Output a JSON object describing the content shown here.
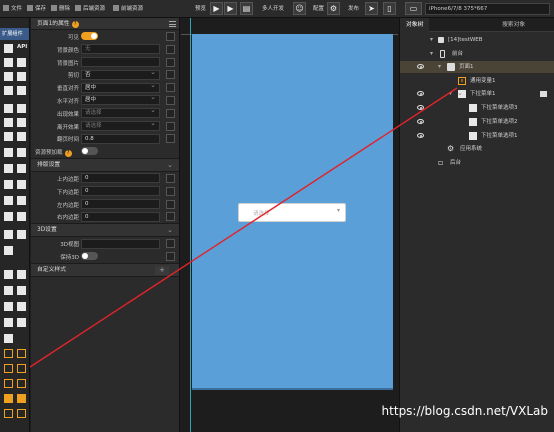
{
  "toolbar": {
    "file": "文件",
    "save": "保存",
    "delete": "删除",
    "preview_res": "后端资源",
    "front_res": "前端资源",
    "preview": "预览",
    "multi_dev": "多人开发",
    "config": "配置",
    "publish": "发布",
    "device": "iPhone6/7/8 375*667"
  },
  "left_tools": {
    "tab": "扩展组件",
    "api": "API"
  },
  "props": {
    "title": "页面1的属性",
    "rows": [
      {
        "label": "可见",
        "type": "toggle_on"
      },
      {
        "label": "背景颜色",
        "value": "无",
        "ph": true
      },
      {
        "label": "背景图片",
        "value": ""
      },
      {
        "label": "剪切",
        "value": "否"
      },
      {
        "label": "垂直对齐",
        "value": "居中"
      },
      {
        "label": "水平对齐",
        "value": "居中"
      },
      {
        "label": "出现效果",
        "value": "请选择",
        "ph": true
      },
      {
        "label": "离开效果",
        "value": "请选择",
        "ph": true
      },
      {
        "label": "翻页时间",
        "value": "0.8"
      }
    ],
    "preload_label": "资源预加载",
    "layout_section": "排版设置",
    "padding_rows": [
      {
        "label": "上内边距",
        "value": "0"
      },
      {
        "label": "下内边距",
        "value": "0"
      },
      {
        "label": "左内边距",
        "value": "0"
      },
      {
        "label": "右内边距",
        "value": "0"
      }
    ],
    "section_3d": "3D设置",
    "row_3d_view": "3D视图",
    "row_keep_3d": "保持3D",
    "custom_section": "自定义样式",
    "custom_plus": "+"
  },
  "canvas": {
    "dropdown_placeholder": "请选择",
    "dropdown_arrow": "▾"
  },
  "objects": {
    "tabs": [
      "对象树",
      "搜索对象"
    ],
    "tree": [
      {
        "label": "[14]testWEB"
      },
      {
        "label": "前台"
      },
      {
        "label": "页面1"
      },
      {
        "label": "通用变量1"
      },
      {
        "label": "下拉菜单1"
      },
      {
        "label": "下拉菜单选项3"
      },
      {
        "label": "下拉菜单选项2"
      },
      {
        "label": "下拉菜单选项1"
      },
      {
        "label": "应用系统"
      },
      {
        "label": "后台"
      }
    ]
  },
  "watermark": "https://blog.csdn.net/VXLab",
  "colors": {
    "accent": "#f0a020",
    "canvas_blue": "#5b9fd8",
    "red_line": "#e0242b"
  }
}
